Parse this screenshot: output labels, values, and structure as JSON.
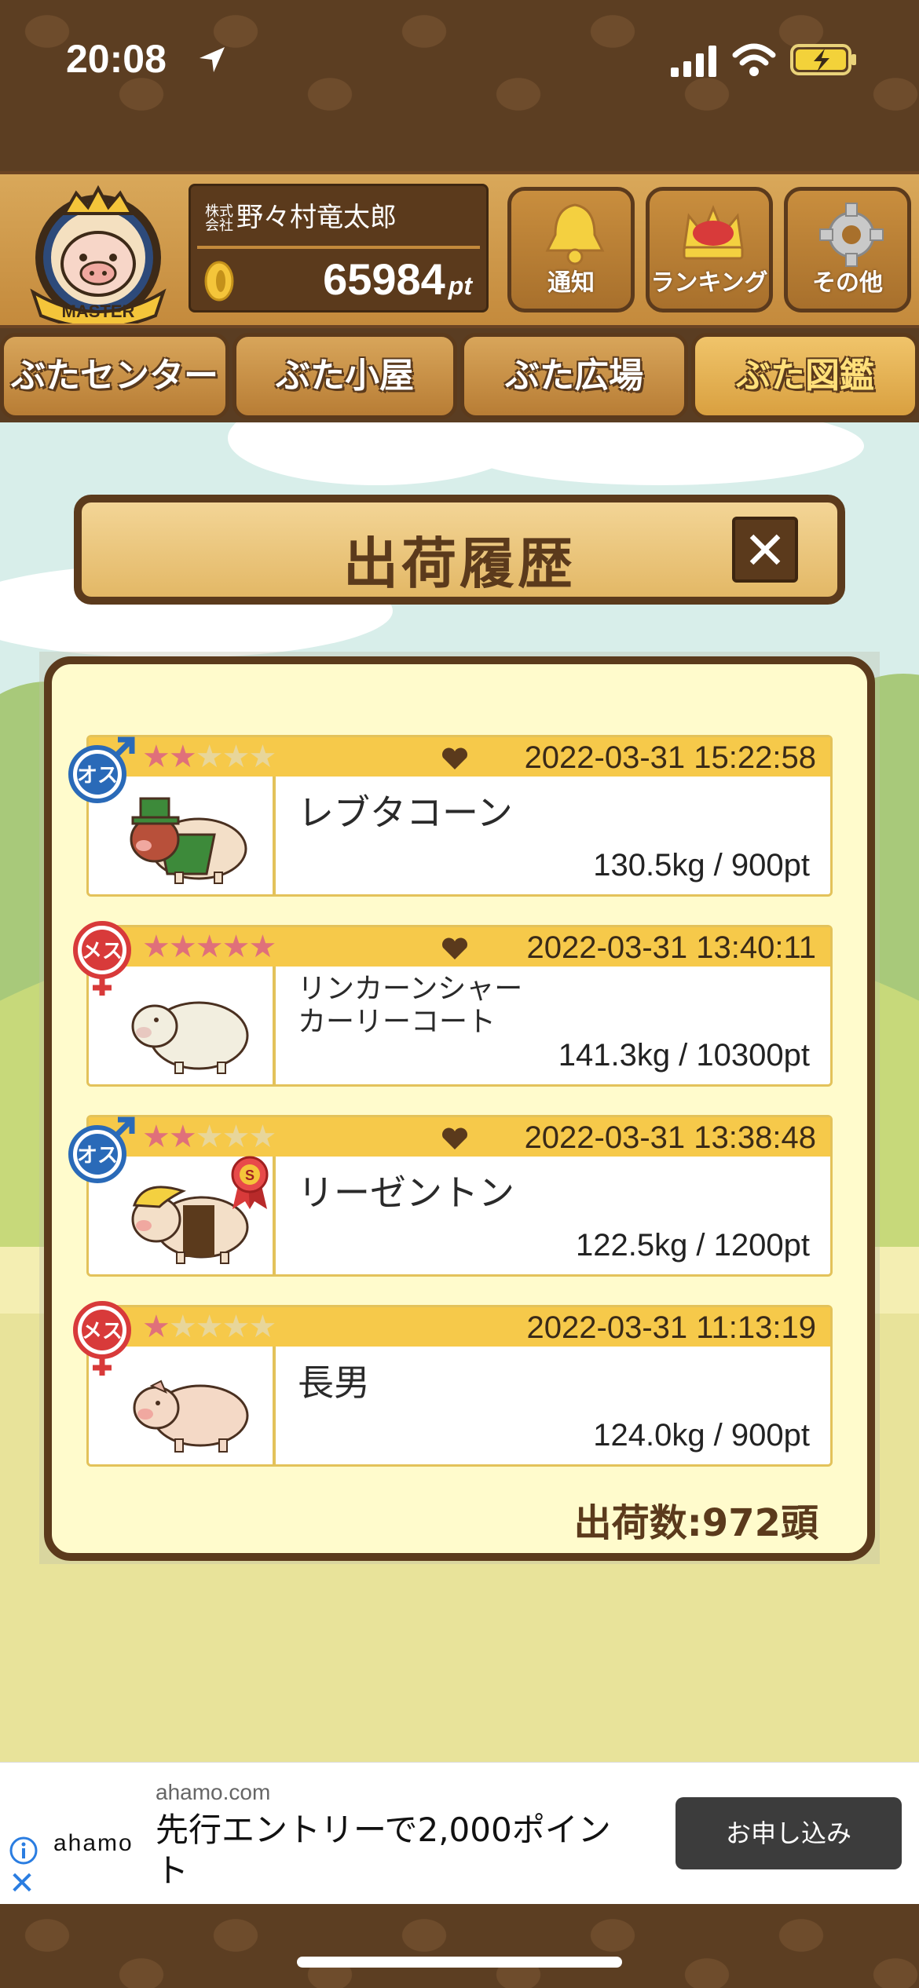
{
  "status_bar": {
    "time": "20:08"
  },
  "header": {
    "badge_label": "MASTER",
    "corp_prefix": "株式会社",
    "user_name": "野々村竜太郎",
    "points": "65984",
    "points_unit": "pt",
    "buttons": [
      {
        "label": "通知",
        "icon": "bell-icon"
      },
      {
        "label": "ランキング",
        "icon": "crown-icon"
      },
      {
        "label": "その他",
        "icon": "gear-icon"
      }
    ]
  },
  "tabs": [
    {
      "label": "ぶたセンター",
      "active": false
    },
    {
      "label": "ぶた小屋",
      "active": false
    },
    {
      "label": "ぶた広場",
      "active": false
    },
    {
      "label": "ぶた図鑑",
      "active": true
    }
  ],
  "dialog": {
    "title": "出荷履歴",
    "close_label": "✕",
    "records": [
      {
        "gender": "オス",
        "gender_icon": "male-icon",
        "stars": 2,
        "favorite": true,
        "datetime": "2022-03-31 15:22:58",
        "name": "レブタコーン",
        "weight_points": "130.5kg / 900pt",
        "pig": "green-hat-pig"
      },
      {
        "gender": "メス",
        "gender_icon": "female-icon",
        "stars": 5,
        "favorite": true,
        "datetime": "2022-03-31 13:40:11",
        "name_line1": "リンカーンシャー",
        "name_line2": "カーリーコート",
        "weight_points": "141.3kg / 10300pt",
        "pig": "curly-coat-pig"
      },
      {
        "gender": "オス",
        "gender_icon": "male-icon",
        "stars": 2,
        "favorite": true,
        "datetime": "2022-03-31 13:38:48",
        "name": "リーゼントン",
        "weight_points": "122.5kg / 1200pt",
        "pig": "pompadour-pig",
        "ribbon": "S"
      },
      {
        "gender": "メス",
        "gender_icon": "female-icon",
        "stars": 1,
        "favorite": false,
        "datetime": "2022-03-31 11:13:19",
        "name": "長男",
        "weight_points": "124.0kg / 900pt",
        "pig": "pink-pig"
      }
    ],
    "total": "出荷数:972頭"
  },
  "ad": {
    "domain": "ahamo.com",
    "logo": "ahamo",
    "text": "先行エントリーで2,000ポイント",
    "button": "お申し込み"
  },
  "colors": {
    "wood_dark": "#5b3a1c",
    "wood_light": "#d9a85a",
    "card_header": "#f6c94a",
    "panel_bg": "#fffbcc",
    "star_on": "#e0707a"
  }
}
